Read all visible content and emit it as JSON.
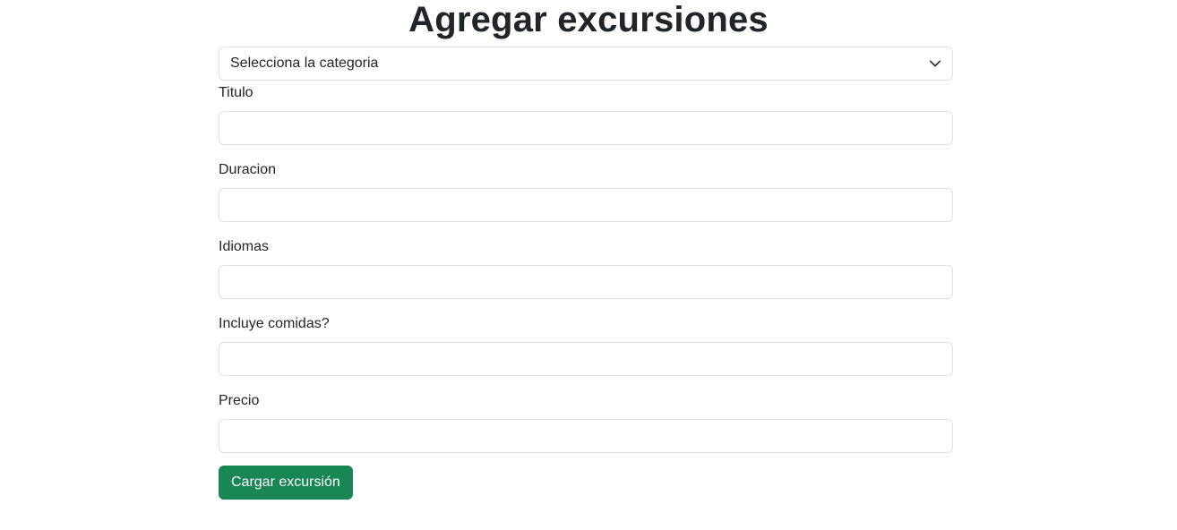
{
  "page": {
    "title": "Agregar excursiones"
  },
  "form": {
    "category_select": {
      "selected": "Selecciona la categoria"
    },
    "fields": [
      {
        "label": "Titulo",
        "value": "",
        "placeholder": ""
      },
      {
        "label": "Duracion",
        "value": "",
        "placeholder": ""
      },
      {
        "label": "Idiomas",
        "value": "",
        "placeholder": ""
      },
      {
        "label": "Incluye comidas?",
        "value": "",
        "placeholder": ""
      },
      {
        "label": "Precio",
        "value": "",
        "placeholder": ""
      }
    ],
    "submit_label": "Cargar excursión"
  },
  "colors": {
    "primary_button": "#198754",
    "border": "#dee2e6",
    "text": "#212529"
  },
  "icons": {
    "select_chevron": "chevron-down-icon"
  }
}
